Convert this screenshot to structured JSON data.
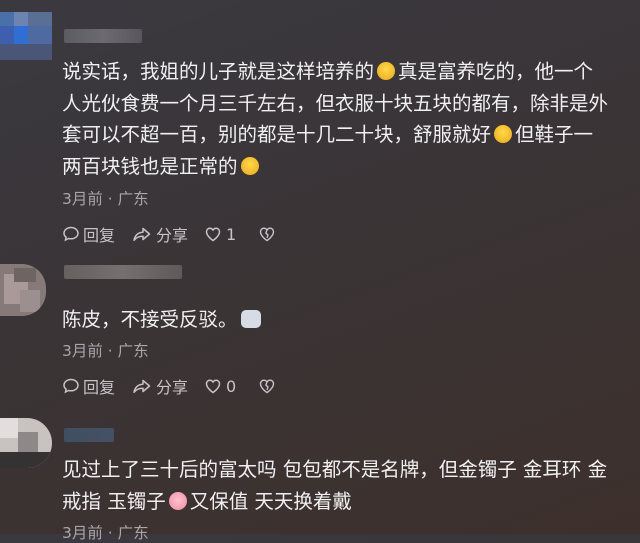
{
  "comments": [
    {
      "lines": [
        [
          "说实话，我姐的儿子就是这样培养的",
          "emoji",
          "真是富养吃的，他一个"
        ],
        [
          "人光伙食费一个月三千左右，但衣服十块五块的都有，除非是外"
        ],
        [
          "套可以不超一百，别的都是十几二十块，舒服就好",
          "emoji",
          "但鞋子一"
        ],
        [
          "两百块钱也是正常的",
          "emoji",
          ""
        ]
      ],
      "meta": "3月前 · 广东",
      "reply_label": "回复",
      "share_label": "分享",
      "like_count": "1",
      "dislike_label": ""
    },
    {
      "lines": [
        [
          "陈皮，不接受反驳。",
          "emoji",
          ""
        ]
      ],
      "meta": "3月前 · 广东",
      "reply_label": "回复",
      "share_label": "分享",
      "like_count": "0",
      "dislike_label": ""
    },
    {
      "lines": [
        [
          "见过上了三十后的富太吗 包包都不是名牌，但金镯子 金耳环 金"
        ],
        [
          "戒指 玉镯子",
          "emoji",
          "又保值 天天换着戴"
        ]
      ],
      "meta": "3月前 · 广东",
      "reply_label": "",
      "share_label": "",
      "like_count": "",
      "dislike_label": ""
    }
  ],
  "colors": {
    "accent_emoji_laugh": "#f6c430",
    "meta_text": "#a9a5ab",
    "action_text": "#c7c3c8"
  },
  "icons": [
    "comment-bubble-icon",
    "share-arrow-icon",
    "heart-icon",
    "broken-heart-icon"
  ]
}
